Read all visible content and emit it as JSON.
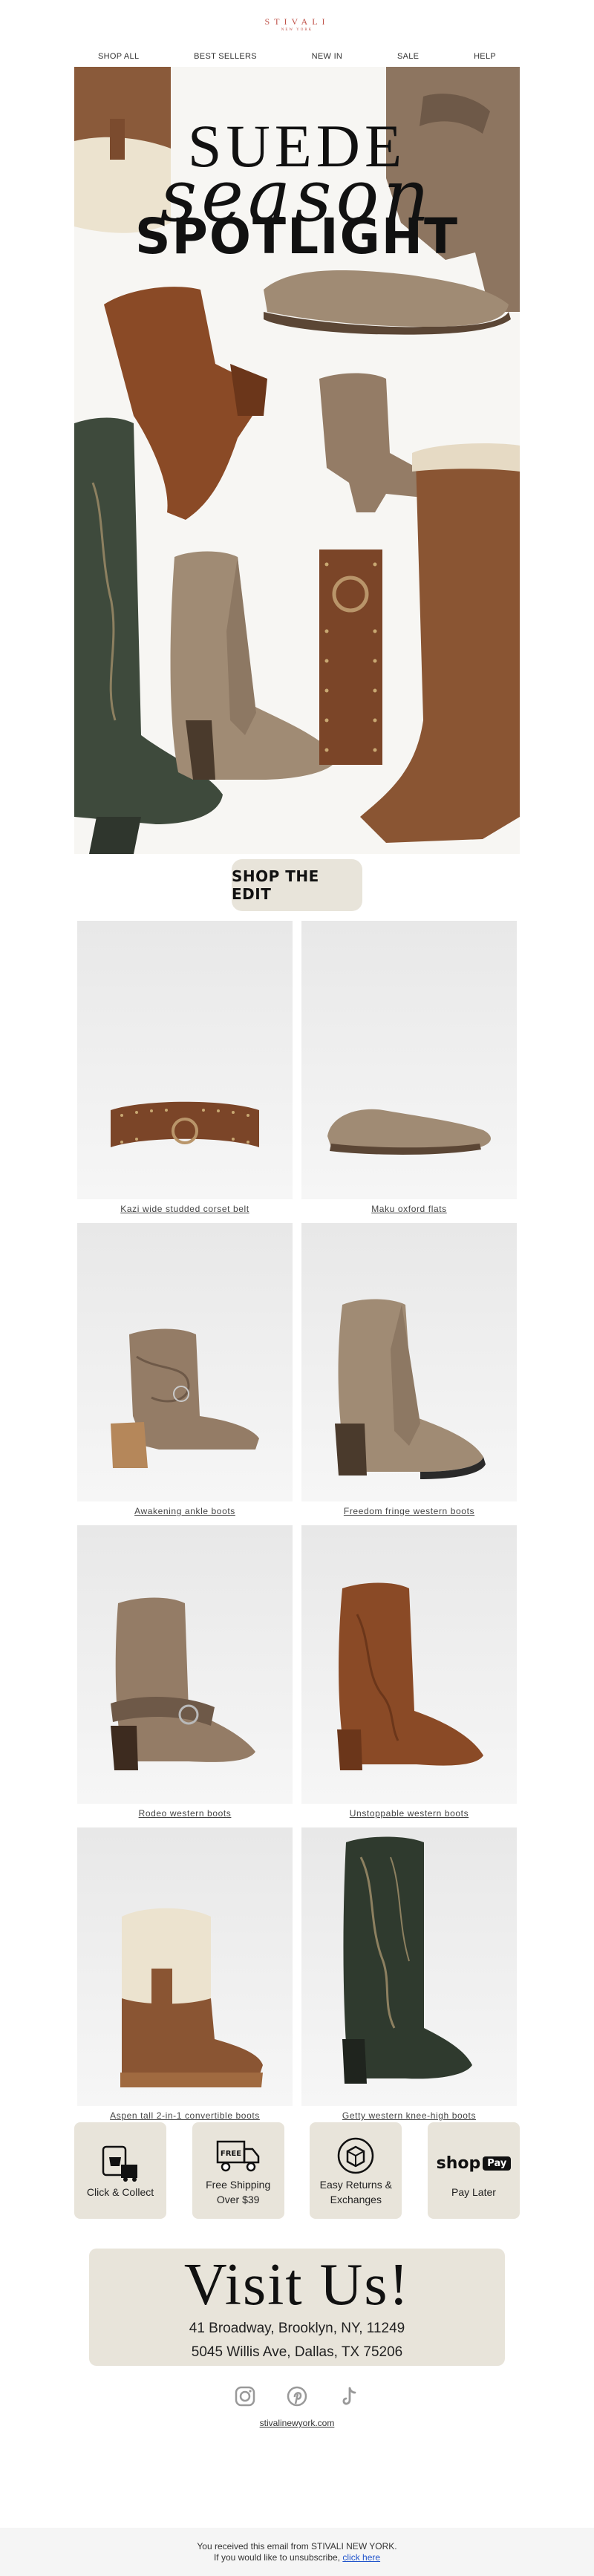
{
  "brand": {
    "name": "STIVALI",
    "sub": "NEW YORK",
    "color": "#c0534a"
  },
  "nav": [
    "SHOP ALL",
    "BEST SELLERS",
    "NEW IN",
    "SALE",
    "HELP"
  ],
  "hero": {
    "line1": "SUEDE",
    "line2": "season",
    "line3": "SPOTLIGHT"
  },
  "cta": "SHOP THE EDIT",
  "products": [
    {
      "name": "Kazi wide studded corset belt",
      "kind": "belt"
    },
    {
      "name": "Maku oxford flats",
      "kind": "flat"
    },
    {
      "name": "Awakening ankle boots",
      "kind": "ankle"
    },
    {
      "name": "Freedom fringe western boots",
      "kind": "fringe"
    },
    {
      "name": "Rodeo western boots",
      "kind": "rodeo"
    },
    {
      "name": "Unstoppable western boots",
      "kind": "rust"
    },
    {
      "name": "Aspen tall 2-in-1 convertible boots",
      "kind": "aspen"
    },
    {
      "name": "Getty western knee-high boots",
      "kind": "getty"
    }
  ],
  "perks": [
    {
      "label": "Click & Collect",
      "icon": "click-collect-icon"
    },
    {
      "label": "Free Shipping Over $39",
      "icon": "free-shipping-icon",
      "badge": "FREE"
    },
    {
      "label": "Easy Returns & Exchanges",
      "icon": "returns-box-icon"
    },
    {
      "label": "Pay Later",
      "icon": "shop-pay-icon",
      "logo_text": "shop",
      "logo_badge": "Pay"
    }
  ],
  "visit": {
    "title": "Visit Us!",
    "address1": "41 Broadway, Brooklyn, NY, 11249",
    "address2": "5045 Willis Ave, Dallas, TX 75206"
  },
  "social": [
    "instagram-icon",
    "pinterest-icon",
    "tiktok-icon"
  ],
  "website": "stivalinewyork.com",
  "footer": {
    "line1": "You received this email from STIVALI NEW YORK.",
    "line2_prefix": "If you would like to unsubscribe,",
    "unsubscribe": "click here"
  },
  "colors": {
    "panel": "#e8e4da",
    "suede_taupe": "#a08b74",
    "suede_rust": "#8a4a26",
    "dark_green": "#3e4a3c"
  }
}
